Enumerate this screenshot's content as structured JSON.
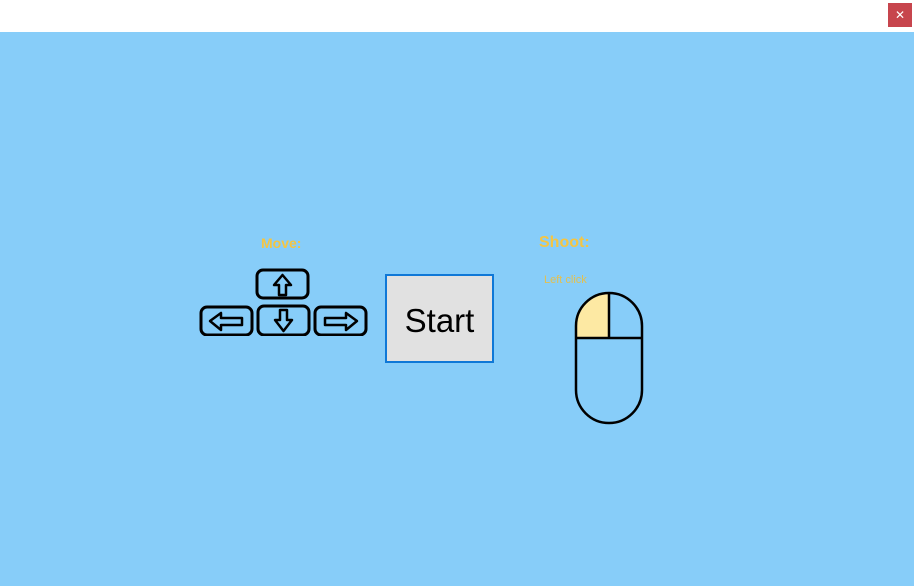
{
  "window": {
    "close_label": "✕"
  },
  "controls": {
    "move_label": "Move:",
    "shoot_label": "Shoot:",
    "left_click_label": "Left click"
  },
  "start_button": {
    "label": "Start"
  },
  "colors": {
    "background": "#87cdf9",
    "label_yellow": "#f5c542",
    "button_face": "#e1e1e1",
    "button_border": "#0f78d7",
    "close_button": "#c7454d",
    "mouse_left_highlight": "#fde9a3"
  },
  "icons": {
    "arrow_keys": [
      "up-arrow-key-icon",
      "left-arrow-key-icon",
      "down-arrow-key-icon",
      "right-arrow-key-icon"
    ],
    "mouse": "mouse-left-click-icon"
  }
}
